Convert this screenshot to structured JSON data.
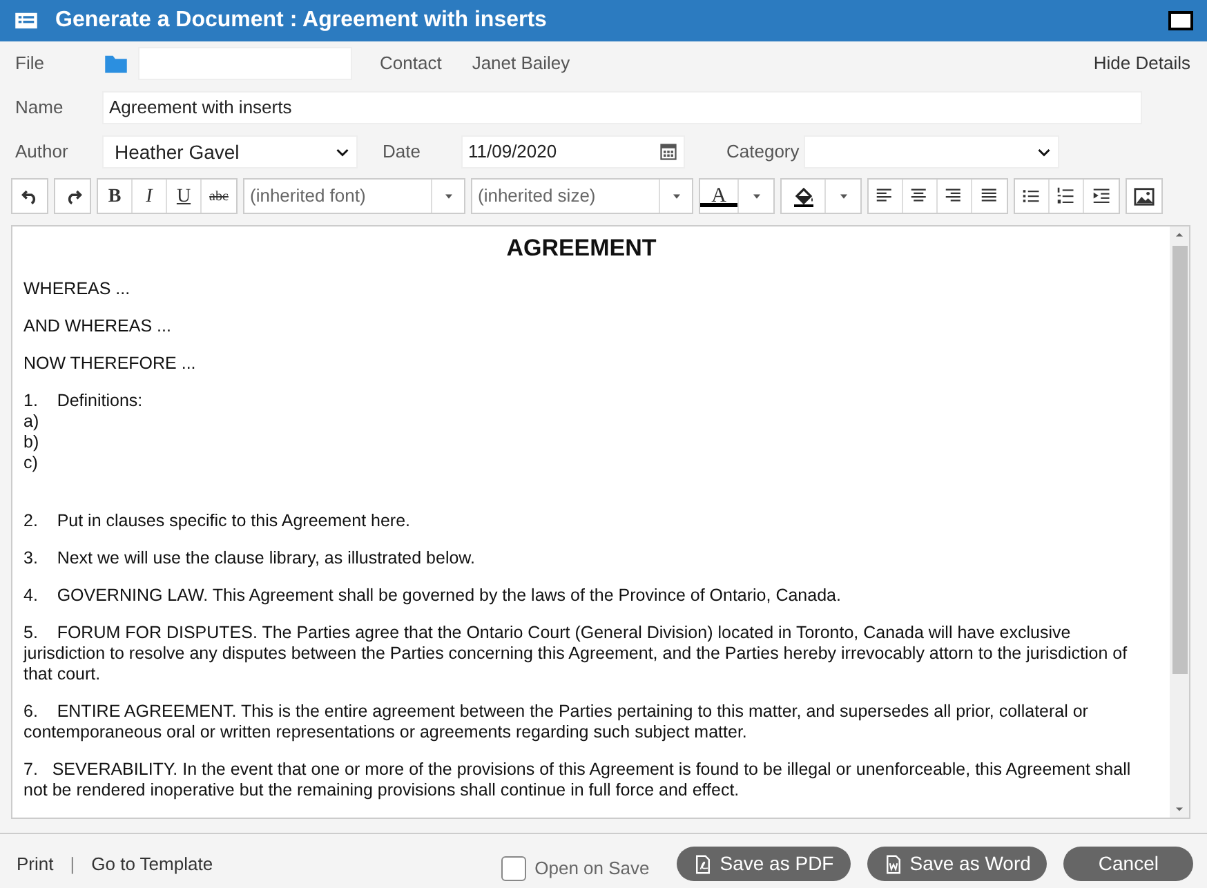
{
  "window": {
    "title": "Generate a Document : Agreement with inserts"
  },
  "details": {
    "file_label": "File",
    "contact_label": "Contact",
    "contact_value": "Janet Bailey",
    "hide_details": "Hide Details",
    "name_label": "Name",
    "name_value": "Agreement with inserts",
    "author_label": "Author",
    "author_value": "Heather Gavel",
    "date_label": "Date",
    "date_value": "11/09/2020",
    "category_label": "Category"
  },
  "toolbar": {
    "bold": "B",
    "italic": "I",
    "underline": "U",
    "strike": "abc",
    "font": "(inherited font)",
    "size": "(inherited size)",
    "font_color": "A"
  },
  "document": [
    {
      "kind": "heading",
      "text": "AGREEMENT"
    },
    {
      "kind": "para",
      "text": "WHEREAS ..."
    },
    {
      "kind": "para",
      "text": "AND WHEREAS ..."
    },
    {
      "kind": "para",
      "text": "NOW THEREFORE ..."
    },
    {
      "kind": "line",
      "text": "1.    Definitions:"
    },
    {
      "kind": "line",
      "text": "a)"
    },
    {
      "kind": "line",
      "text": "b)"
    },
    {
      "kind": "para",
      "text": "c)"
    },
    {
      "kind": "blank"
    },
    {
      "kind": "para",
      "text": "2.    Put in clauses specific to this Agreement here."
    },
    {
      "kind": "para",
      "text": "3.    Next we will use the clause library, as illustrated below."
    },
    {
      "kind": "para",
      "text": "4.    GOVERNING LAW. This Agreement shall be governed by the laws of the Province of Ontario, Canada."
    },
    {
      "kind": "para",
      "text": "5.    FORUM FOR DISPUTES. The Parties agree that the Ontario Court (General Division) located in Toronto, Canada will have exclusive jurisdiction to resolve any disputes between the Parties concerning this Agreement, and the Parties hereby irrevocably attorn to the jurisdiction of that court."
    },
    {
      "kind": "para",
      "text": "6.    ENTIRE AGREEMENT. This is the entire agreement between the Parties pertaining to this matter, and supersedes all prior, collateral or contemporaneous oral or written representations or agreements regarding such subject matter."
    },
    {
      "kind": "para",
      "text": "7.   SEVERABILITY. In the event that one or more of the provisions of this Agreement is found to be illegal or unenforceable, this Agreement shall not be rendered inoperative but the remaining provisions shall continue in full force and effect."
    }
  ],
  "footer": {
    "print": "Print",
    "separator": "|",
    "template": "Go to Template",
    "open_on_save": {
      "label": "Open on Save",
      "checked": false
    },
    "buttons": [
      "Save as PDF",
      "Save as Word",
      "Cancel"
    ]
  }
}
